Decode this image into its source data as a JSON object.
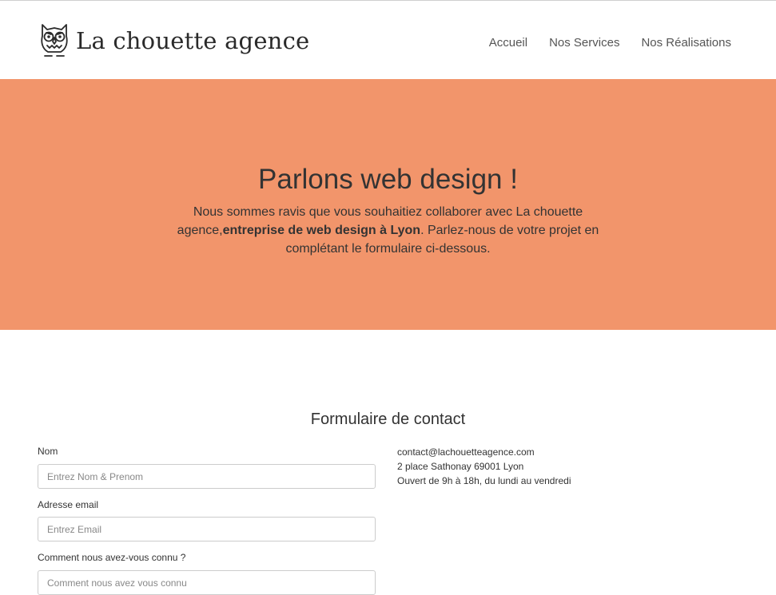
{
  "header": {
    "logo_text": "La chouette agence",
    "nav": [
      {
        "label": "Accueil"
      },
      {
        "label": "Nos Services"
      },
      {
        "label": "Nos Réalisations"
      }
    ]
  },
  "hero": {
    "title": "Parlons web design !",
    "text_before": "Nous sommes ravis que vous souhaitiez collaborer avec La chouette agence,",
    "text_bold": "entreprise de web design à Lyon",
    "text_after": ". Parlez-nous de votre projet en complétant le formulaire ci-dessous.",
    "background_color": "#f2956b"
  },
  "contact": {
    "title": "Formulaire de contact",
    "fields": [
      {
        "label": "Nom",
        "placeholder": "Entrez Nom & Prenom"
      },
      {
        "label": "Adresse email",
        "placeholder": "Entrez Email"
      },
      {
        "label": "Comment nous avez-vous connu ?",
        "placeholder": "Comment nous avez vous connu"
      }
    ],
    "info": {
      "email": "contact@lachouetteagence.com",
      "address": "2 place Sathonay 69001 Lyon",
      "hours": "Ouvert de 9h à 18h, du lundi au vendredi"
    }
  },
  "icons": {
    "logo": "owl-icon"
  }
}
